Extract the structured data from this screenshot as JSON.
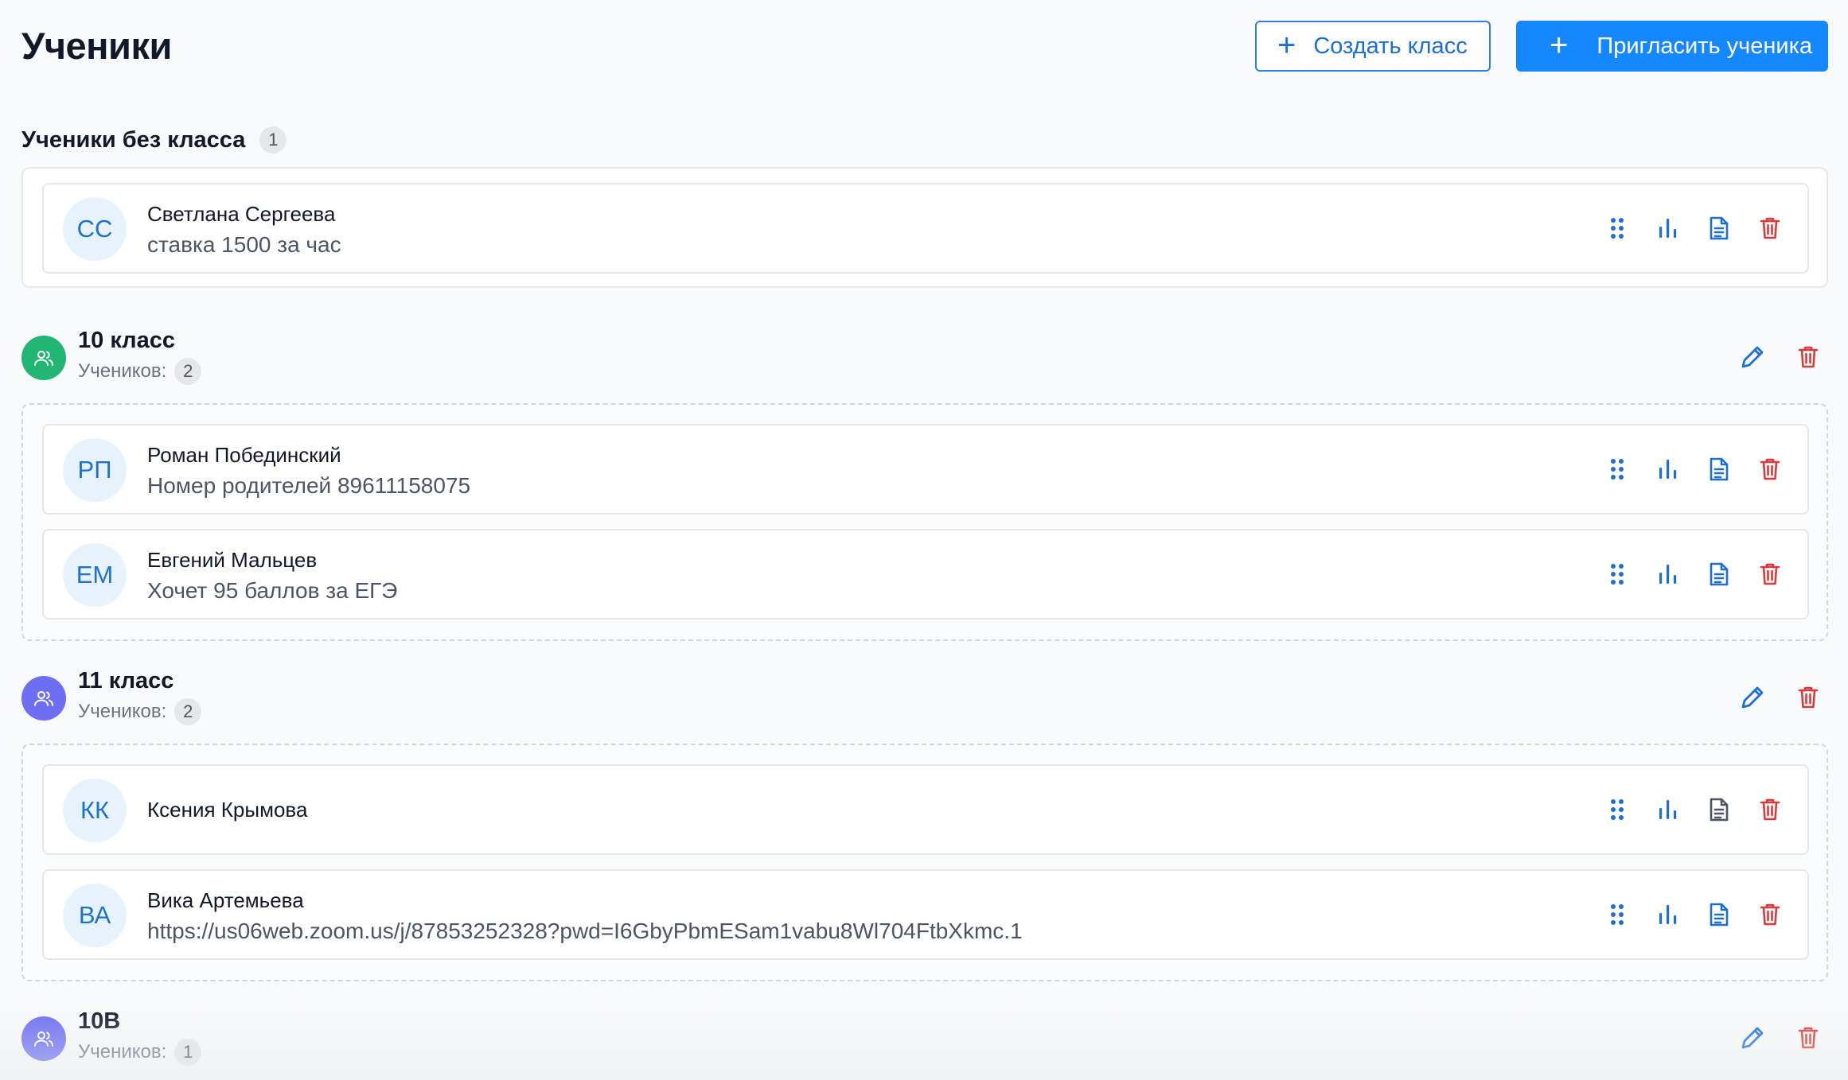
{
  "header": {
    "title": "Ученики",
    "create_class_label": "Создать класс",
    "invite_student_label": "Пригласить ученика"
  },
  "unassigned": {
    "title": "Ученики без класса",
    "count": "1",
    "students": [
      {
        "initials": "СС",
        "name": "Светлана Сергеева",
        "note": "ставка 1500 за час"
      }
    ]
  },
  "classes": [
    {
      "name": "10 класс",
      "count_label": "Учеников:",
      "count": "2",
      "icon_color": "#22b573",
      "students": [
        {
          "initials": "РП",
          "name": "Роман Побединский",
          "note": "Номер родителей 89611158075"
        },
        {
          "initials": "ЕМ",
          "name": "Евгений Мальцев",
          "note": "Хочет 95 баллов за ЕГЭ"
        }
      ]
    },
    {
      "name": "11 класс",
      "count_label": "Учеников:",
      "count": "2",
      "icon_color": "#6d6ef2",
      "students": [
        {
          "initials": "КК",
          "name": "Ксения Крымова",
          "note": ""
        },
        {
          "initials": "ВА",
          "name": "Вика Артемьева",
          "note": "https://us06web.zoom.us/j/87853252328?pwd=I6GbyPbmESam1vabu8Wl704FtbXkmc.1"
        }
      ]
    },
    {
      "name": "10В",
      "count_label": "Учеников:",
      "count": "1",
      "icon_color": "#6d6ef2",
      "students": []
    }
  ],
  "colors": {
    "primary": "#1688ff",
    "danger": "#d93b3b",
    "icon_blue": "#1d6fd1"
  }
}
